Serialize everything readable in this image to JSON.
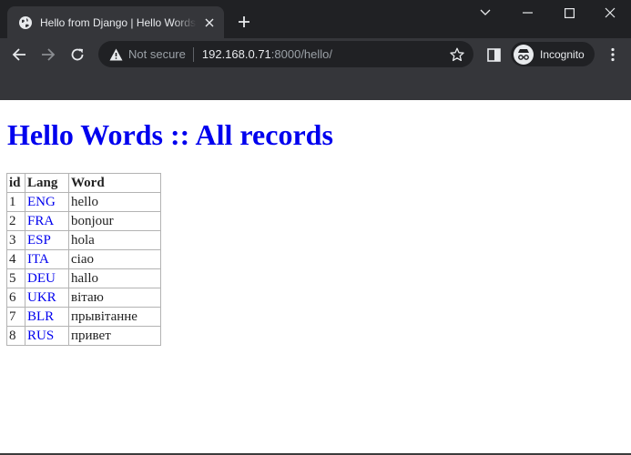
{
  "browser": {
    "tab_title": "Hello from Django | Hello Words",
    "omnibox": {
      "security_label": "Not secure",
      "url_host": "192.168.0.71",
      "url_rest": ":8000/hello/"
    },
    "profile_label": "Incognito",
    "icons": {
      "tab_favicon": "globe-icon",
      "tab_close": "close-icon",
      "new_tab": "plus-icon",
      "tab_search": "chevron-down-icon",
      "minimize": "minimize-icon",
      "maximize": "maximize-icon",
      "close_window": "close-icon",
      "back": "arrow-left-icon",
      "forward": "arrow-right-icon",
      "reload": "reload-icon",
      "security": "warning-icon",
      "bookmark": "star-icon",
      "side_panel": "side-panel-icon",
      "incognito": "incognito-icon",
      "menu": "kebab-menu-icon"
    },
    "colors": {
      "tabstrip": "#202124",
      "toolbar": "#35363a",
      "text": "#e8eaed",
      "muted_text": "#9aa0a6"
    }
  },
  "page": {
    "heading": "Hello Words :: All records",
    "table": {
      "columns": [
        "id",
        "Lang",
        "Word"
      ],
      "rows": [
        {
          "id": "1",
          "lang": "ENG",
          "word": "hello"
        },
        {
          "id": "2",
          "lang": "FRA",
          "word": "bonjour"
        },
        {
          "id": "3",
          "lang": "ESP",
          "word": "hola"
        },
        {
          "id": "4",
          "lang": "ITA",
          "word": "ciao"
        },
        {
          "id": "5",
          "lang": "DEU",
          "word": "hallo"
        },
        {
          "id": "6",
          "lang": "UKR",
          "word": "вітаю"
        },
        {
          "id": "7",
          "lang": "BLR",
          "word": "прывітанне"
        },
        {
          "id": "8",
          "lang": "RUS",
          "word": "привет"
        }
      ]
    },
    "colors": {
      "link": "#0000ee",
      "heading": "#0000ee"
    }
  }
}
